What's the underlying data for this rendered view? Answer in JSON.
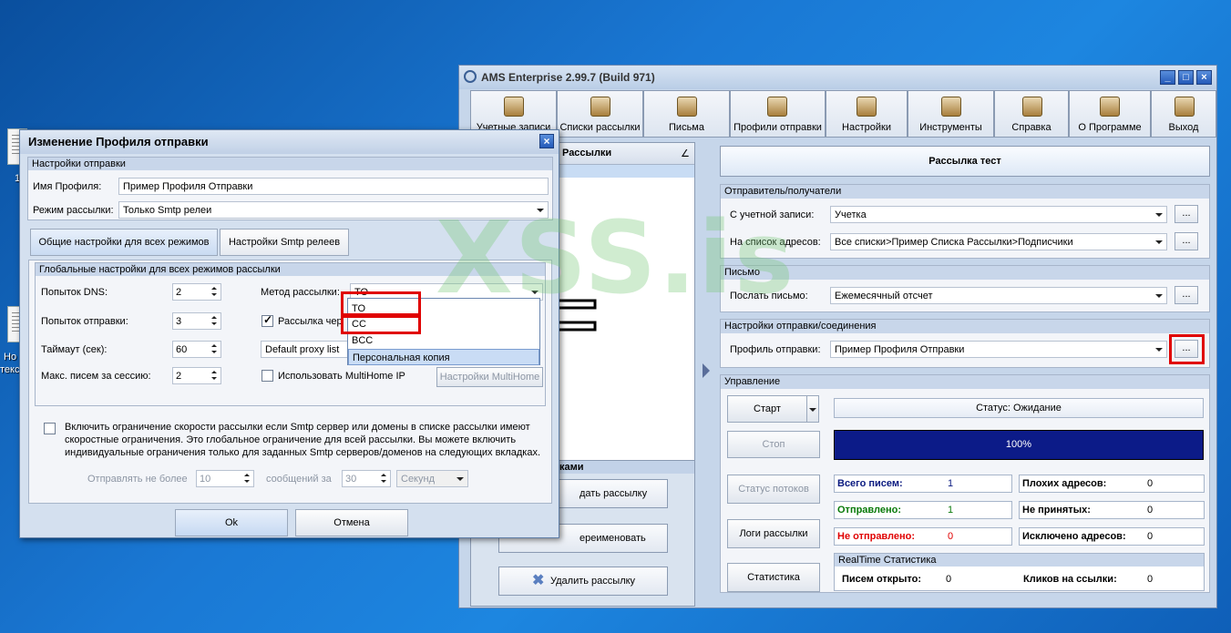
{
  "desktop": {
    "icon_labels": [
      "1",
      "Но",
      "текс"
    ]
  },
  "main_window": {
    "title": "AMS Enterprise 2.99.7 (Build 971)",
    "controls": {
      "minimize": "_",
      "maximize": "□",
      "close": "×"
    },
    "toolbar": [
      {
        "label": "Учетные записи",
        "icon": "accounts-icon"
      },
      {
        "label": "Списки рассылки",
        "icon": "mailing-lists-icon"
      },
      {
        "label": "Письма",
        "icon": "letters-icon"
      },
      {
        "label": "Профили отправки",
        "icon": "send-profiles-icon"
      },
      {
        "label": "Настройки",
        "icon": "settings-icon"
      },
      {
        "label": "Инструменты",
        "icon": "tools-icon"
      },
      {
        "label": "Справка",
        "icon": "help-icon"
      },
      {
        "label": "О Программе",
        "icon": "about-icon"
      },
      {
        "label": "Выход",
        "icon": "exit-icon"
      }
    ],
    "left_panel": {
      "header": "Рассылки",
      "sort_mark": "∠",
      "section_title": "лками",
      "buttons": {
        "create": "дать рассылку",
        "rename": "ереименовать",
        "delete": "Удалить рассылку"
      }
    },
    "banner": "Рассылка тест",
    "sender_group": {
      "title": "Отправитель/получатели",
      "account_label": "С учетной записи:",
      "account_value": "Учетка",
      "list_label": "На список адресов:",
      "list_value": "Все списки>Пример Списка Рассылки>Подписчики"
    },
    "letter_group": {
      "title": "Письмо",
      "send_label": "Послать письмо:",
      "send_value": "Ежемесячный отсчет"
    },
    "connection_group": {
      "title": "Настройки отправки/соединения",
      "profile_label": "Профиль отправки:",
      "profile_value": "Пример Профиля Отправки"
    },
    "ellipsis": "...",
    "control_group": {
      "title": "Управление",
      "start": "Старт",
      "stop": "Стоп",
      "status": "Статус: Ожидание",
      "progress_text": "100%",
      "progress": 1.0,
      "threads_status": "Статус потоков",
      "logs": "Логи рассылки",
      "statistics": "Статистика"
    },
    "stats": [
      {
        "label": "Всего писем:",
        "value": "1",
        "color": "#0a1a80"
      },
      {
        "label": "Плохих адресов:",
        "value": "0",
        "color": "#000000"
      },
      {
        "label": "Отправлено:",
        "value": "1",
        "color": "#0a7a0a"
      },
      {
        "label": "Не принятых:",
        "value": "0",
        "color": "#000000"
      },
      {
        "label": "Не отправлено:",
        "value": "0",
        "color": "#e00000"
      },
      {
        "label": "Исключено адресов:",
        "value": "0",
        "color": "#000000"
      }
    ],
    "realtime": {
      "title": "RealTime Статистика",
      "opened_label": "Писем открыто:",
      "opened_value": "0",
      "clicks_label": "Кликов на ссылки:",
      "clicks_value": "0"
    }
  },
  "dialog": {
    "title": "Изменение Профиля отправки",
    "close": "×",
    "send_settings": {
      "title": "Настройки отправки",
      "profile_name_label": "Имя Профиля:",
      "profile_name_value": "Пример Профиля Отправки",
      "mode_label": "Режим рассылки:",
      "mode_value": "Только Smtp релеи"
    },
    "tabs": [
      "Общие настройки для всех режимов",
      "Настройки Smtp релеев"
    ],
    "global": {
      "title": "Глобальные настройки для всех режимов рассылки",
      "dns_label": "Попыток DNS:",
      "dns_value": "2",
      "send_attempts_label": "Попыток отправки:",
      "send_attempts_value": "3",
      "timeout_label": "Таймаут (сек):",
      "timeout_value": "60",
      "max_label": "Макс. писем за сессию:",
      "max_value": "2",
      "method_label": "Метод рассылки:",
      "method_value": "TO",
      "send_via_label": "Рассылка чер",
      "proxy_value": "Default proxy list",
      "multihome_label": "Использовать MultiHome IP",
      "multihome_button": "Настройки MultiHome"
    },
    "method_options": [
      "TO",
      "CC",
      "BCC",
      "Персональная копия"
    ],
    "limit_text": "Включить ограничение скорости рассылки если Smtp сервер или домены в списке рассылки имеют скоростные ограничения. Это глобальное ограничение для всей рассылки. Вы можете включить индивидуальные ограничения только для заданных Smtp серверов/доменов на следующих вкладках.",
    "limit": {
      "send_no_more_label": "Отправлять не более",
      "send_no_more_value": "10",
      "messages_per_label": "сообщений за",
      "messages_per_value": "30",
      "unit_value": "Секунд"
    },
    "ok": "Ok",
    "cancel": "Отмена"
  },
  "watermark": "XSS.is",
  "colors": {
    "highlight_red": "#e00000",
    "progress_blue": "#0c1b88"
  }
}
